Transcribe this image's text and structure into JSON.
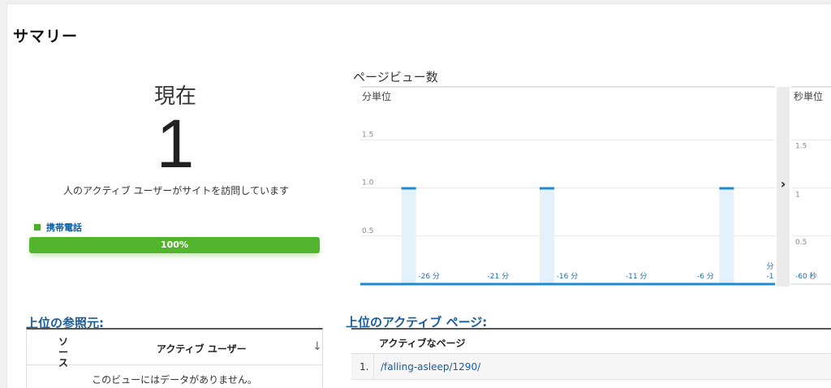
{
  "page": {
    "title": "サマリー"
  },
  "current": {
    "label": "現在",
    "count": "1",
    "description": "人のアクティブ ユーザーがサイトを訪問しています"
  },
  "devices": [
    {
      "label": "携帯電話",
      "percent_label": "100%",
      "percent": 100,
      "color": "#53b52e"
    }
  ],
  "pageviews": {
    "title": "ページビュー数",
    "minutes_label": "分単位",
    "seconds_label": "秒単位",
    "expand_label": "›",
    "accent_color": "#1e8ad0"
  },
  "chart_data": [
    {
      "type": "bar",
      "title": "分単位",
      "x_unit": "分",
      "x": [
        -30,
        -29,
        -28,
        -27,
        -26,
        -25,
        -24,
        -23,
        -22,
        -21,
        -20,
        -19,
        -18,
        -17,
        -16,
        -15,
        -14,
        -13,
        -12,
        -11,
        -10,
        -9,
        -8,
        -7,
        -6,
        -5,
        -4,
        -3,
        -2,
        -1
      ],
      "values": [
        0,
        0,
        0,
        1,
        0,
        0,
        0,
        0,
        0,
        0,
        0,
        0,
        0,
        1,
        0,
        0,
        0,
        0,
        0,
        0,
        0,
        0,
        0,
        0,
        0,
        0,
        1,
        0,
        0,
        0
      ],
      "x_tick_labels": [
        "-26 分",
        "-21 分",
        "-16 分",
        "-11 分",
        "-6 分",
        "分 -1"
      ],
      "y_tick_labels": [
        "0.5",
        "1.0",
        "1.5"
      ],
      "ylim": [
        0,
        2
      ],
      "grid": true
    },
    {
      "type": "bar",
      "title": "秒単位",
      "x_unit": "秒",
      "x_tick_labels": [
        "-60 秒"
      ],
      "y_tick_labels": [
        "0.5",
        "1",
        "1.5"
      ],
      "ylim": [
        0,
        2
      ],
      "grid": true
    }
  ],
  "referrers": {
    "title": "上位の参照元:",
    "col_source": "ソース",
    "col_users": "アクティブ ユーザー",
    "empty_message": "このビューにはデータがありません。"
  },
  "active_pages": {
    "title": "上位のアクティブ ページ:",
    "col_page": "アクティブなページ",
    "rows": [
      {
        "num": "1.",
        "path": "/falling-asleep/1290/"
      }
    ]
  }
}
